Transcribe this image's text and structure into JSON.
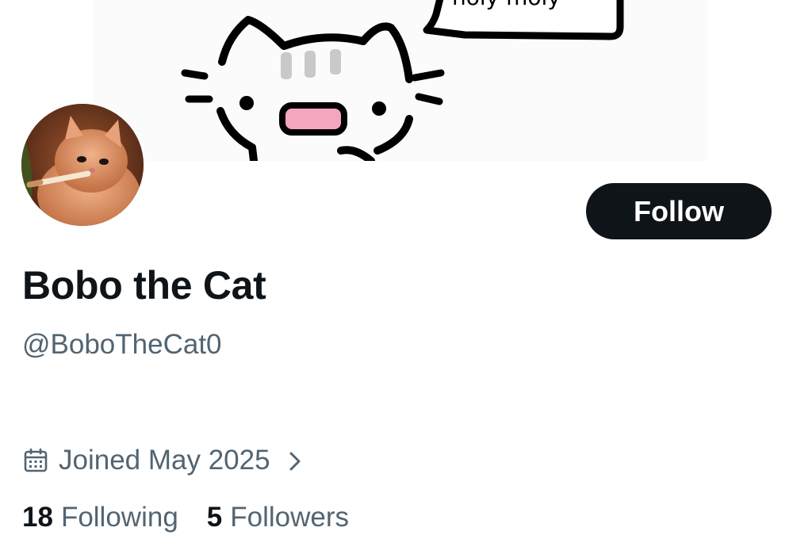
{
  "banner": {
    "speech_text": "holy moly"
  },
  "profile": {
    "display_name": "Bobo the Cat",
    "handle": "@BoboTheCat0",
    "follow_label": "Follow",
    "joined": "Joined May 2025",
    "following_count": "18",
    "following_label": "Following",
    "followers_count": "5",
    "followers_label": "Followers"
  },
  "colors": {
    "text_primary": "#0f1419",
    "text_secondary": "#536471",
    "button_bg": "#0f1419",
    "button_text": "#ffffff"
  },
  "icons": {
    "joined": "calendar-icon",
    "joined_more": "chevron-right-icon"
  }
}
